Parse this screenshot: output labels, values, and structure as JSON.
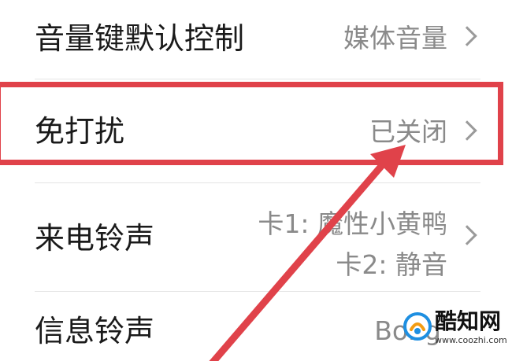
{
  "settings": {
    "volume_key_default": {
      "label": "音量键默认控制",
      "value": "媒体音量",
      "chevron_icon": "chevron-right-icon"
    },
    "do_not_disturb": {
      "label": "免打扰",
      "value": "已关闭",
      "chevron_icon": "chevron-right-icon"
    },
    "ringtone": {
      "label": "来电铃声",
      "value_sim1": "卡1: 魔性小黄鸭",
      "value_sim2": "卡2: 静音",
      "chevron_icon": "chevron-right-icon"
    },
    "message_tone": {
      "label": "信息铃声",
      "value": "Bong"
    }
  },
  "annotation": {
    "highlight_color": "#e0424a",
    "arrow_icon": "red-arrow-icon"
  },
  "watermark": {
    "name": "酷知网",
    "url": "www.coozhi.com",
    "logo_icon": "coozhi-logo-icon"
  }
}
